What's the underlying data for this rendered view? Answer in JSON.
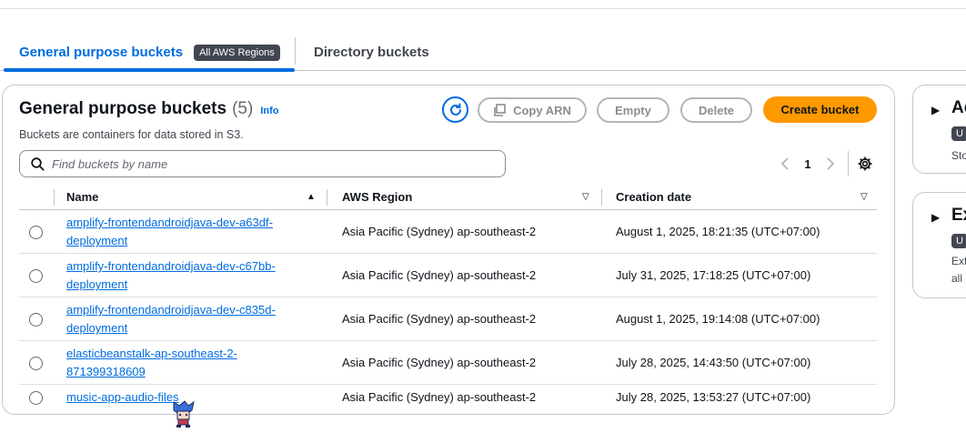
{
  "tabs": {
    "active_label": "General purpose buckets",
    "active_badge": "All AWS Regions",
    "inactive_label": "Directory buckets"
  },
  "panel": {
    "title": "General purpose buckets",
    "count": "(5)",
    "info": "Info",
    "description": "Buckets are containers for data stored in S3."
  },
  "toolbar": {
    "copy_arn": "Copy ARN",
    "empty": "Empty",
    "delete": "Delete",
    "create": "Create bucket"
  },
  "search": {
    "placeholder": "Find buckets by name"
  },
  "pagination": {
    "page": "1"
  },
  "table": {
    "headers": {
      "name": "Name",
      "region": "AWS Region",
      "date": "Creation date"
    },
    "rows": [
      {
        "name": "amplify-frontendandroidjava-dev-a63df-deployment",
        "region": "Asia Pacific (Sydney) ap-southeast-2",
        "date": "August 1, 2025, 18:21:35 (UTC+07:00)"
      },
      {
        "name": "amplify-frontendandroidjava-dev-c67bb-deployment",
        "region": "Asia Pacific (Sydney) ap-southeast-2",
        "date": "July 31, 2025, 17:18:25 (UTC+07:00)"
      },
      {
        "name": "amplify-frontendandroidjava-dev-c835d-deployment",
        "region": "Asia Pacific (Sydney) ap-southeast-2",
        "date": "August 1, 2025, 19:14:08 (UTC+07:00)"
      },
      {
        "name": "elasticbeanstalk-ap-southeast-2-871399318609",
        "region": "Asia Pacific (Sydney) ap-southeast-2",
        "date": "July 28, 2025, 14:43:50 (UTC+07:00)"
      },
      {
        "name": "music-app-audio-files",
        "region": "Asia Pacific (Sydney) ap-southeast-2",
        "date": "July 28, 2025, 13:53:27 (UTC+07:00)"
      }
    ]
  },
  "side_panels": [
    {
      "title": "Ac",
      "badge": "U",
      "text1": "Sto",
      "text2": ""
    },
    {
      "title": "Ex",
      "badge": "U",
      "text1": "Ext",
      "text2": "all"
    }
  ],
  "colors": {
    "accent": "#006ce0",
    "primary_button": "#ff9900",
    "badge_bg": "#424650"
  }
}
